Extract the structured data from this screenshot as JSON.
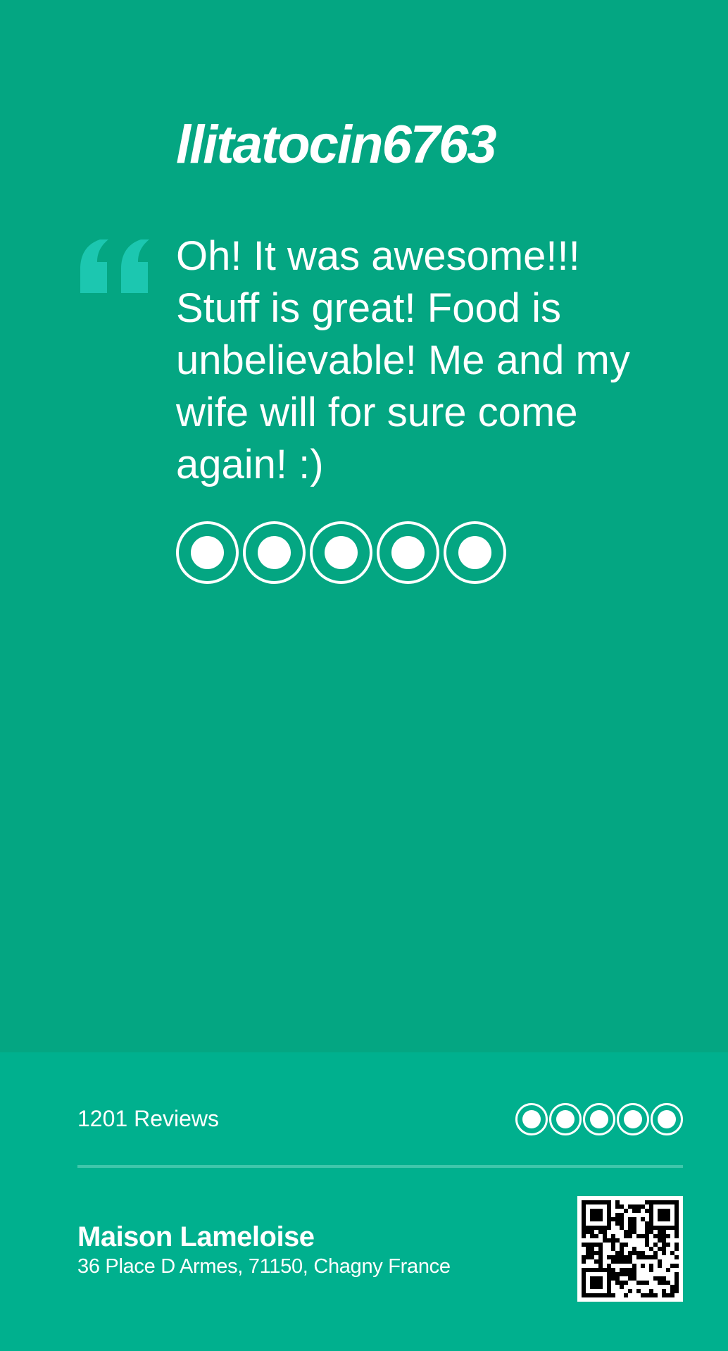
{
  "review": {
    "reviewer_name": "llitatocin6763",
    "quote_icon": "quote-open-icon",
    "text": "Oh! It was awesome!!! Stuff is great! Food is unbelievable! Me and my wife will for sure come again! :)",
    "rating": 5,
    "rating_max": 5
  },
  "footer": {
    "reviews_count_label": "1201 Reviews",
    "rating": 5,
    "rating_max": 5,
    "business_name": "Maison Lameloise",
    "business_address": "36 Place D Armes, 71150, Chagny France",
    "qr_icon": "qr-code-icon"
  },
  "colors": {
    "main_background": "#04a682",
    "footer_background": "#00b08e",
    "quote_mark": "#1cc7b0",
    "divider": "#3fc7ab",
    "text": "#ffffff"
  }
}
